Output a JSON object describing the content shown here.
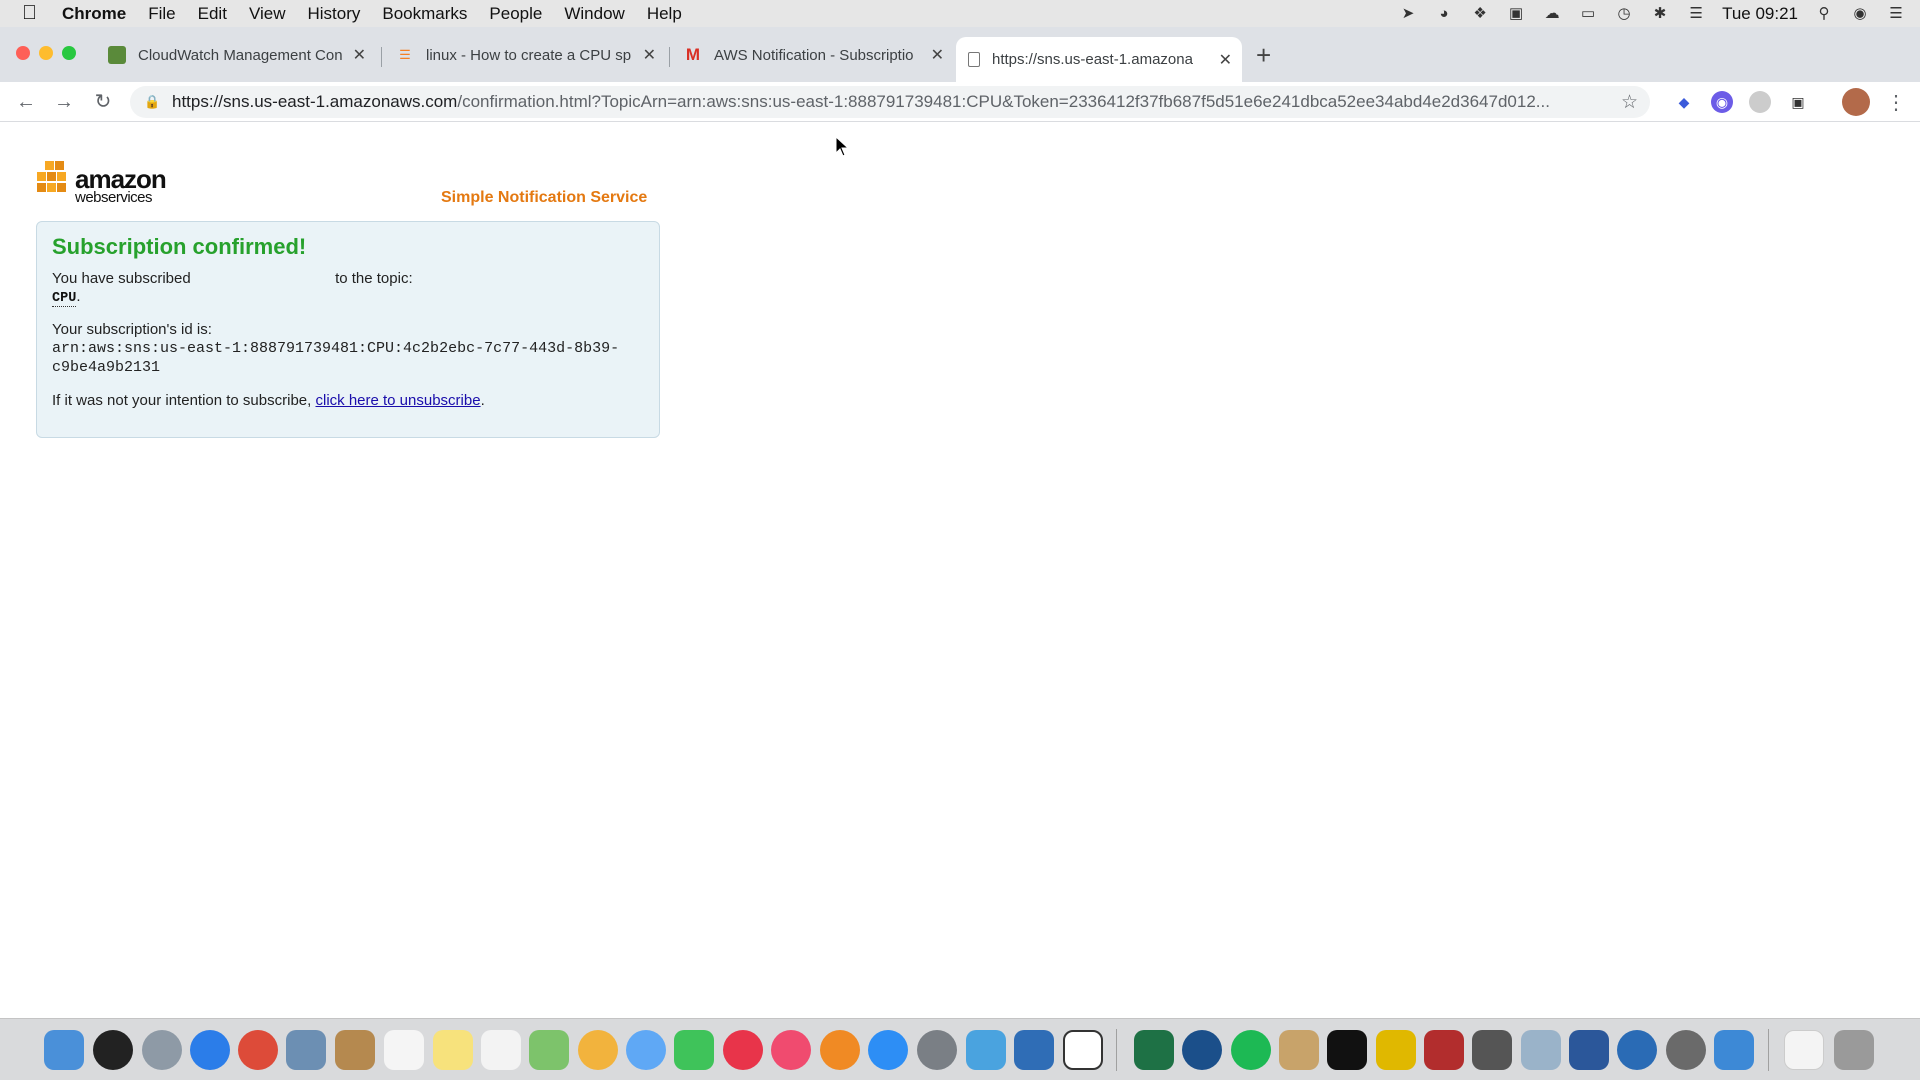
{
  "menubar": {
    "app": "Chrome",
    "items": [
      "File",
      "Edit",
      "View",
      "History",
      "Bookmarks",
      "People",
      "Window",
      "Help"
    ],
    "clock": "Tue 09:21"
  },
  "tabs": [
    {
      "title": "CloudWatch Management Con",
      "favicon": "cloudwatch-icon"
    },
    {
      "title": "linux - How to create a CPU sp",
      "favicon": "stackoverflow-icon"
    },
    {
      "title": "AWS Notification - Subscriptio",
      "favicon": "gmail-icon"
    },
    {
      "title": "https://sns.us-east-1.amazona",
      "favicon": "page-icon"
    }
  ],
  "address": {
    "host": "https://sns.us-east-1.amazonaws.com",
    "path": "/confirmation.html?TopicArn=arn:aws:sns:us-east-1:888791739481:CPU&Token=2336412f37fb687f5d51e6e241dbca52ee34abd4e2d3647d012..."
  },
  "page": {
    "logo_big": "amazon",
    "logo_small": "webservices",
    "service_name": "Simple Notification Service",
    "heading": "Subscription confirmed!",
    "subscribed_prefix": "You have subscribed",
    "subscribed_suffix": "to the topic:",
    "topic": "CPU",
    "id_label": "Your subscription's id is:",
    "id_line1": "arn:aws:sns:us-east-1:888791739481:CPU:4c2b2ebc-7c77-443d-8b39-",
    "id_line2": "c9be4a9b2131",
    "unsub_prefix": "If it was not your intention to subscribe,",
    "unsub_link": "click here to unsubscribe"
  },
  "colors": {
    "heading_green": "#27a12d",
    "service_orange": "#e47911",
    "panel_bg": "#eaf3f7"
  }
}
